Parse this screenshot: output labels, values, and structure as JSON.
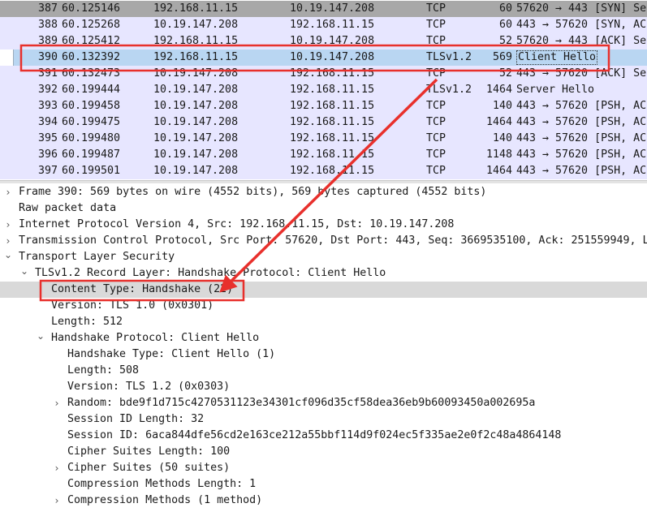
{
  "colors": {
    "tcp_row_bg": "#e7e6ff",
    "selected_row_bg": "#b9d6f2",
    "header_row_bg": "#a8a8a8",
    "annotation_red": "#e8302c",
    "selected_detail_bg": "#d9d9d9"
  },
  "packets": [
    {
      "no": "387",
      "time": "60.125146",
      "src": "192.168.11.15",
      "dst": "10.19.147.208",
      "proto": "TCP",
      "len": "60",
      "info": "57620 → 443 [SYN] Se",
      "style": "header"
    },
    {
      "no": "388",
      "time": "60.125268",
      "src": "10.19.147.208",
      "dst": "192.168.11.15",
      "proto": "TCP",
      "len": "60",
      "info": "443 → 57620 [SYN, AC",
      "style": "tcp"
    },
    {
      "no": "389",
      "time": "60.125412",
      "src": "192.168.11.15",
      "dst": "10.19.147.208",
      "proto": "TCP",
      "len": "52",
      "info": "57620 → 443 [ACK] Se",
      "style": "tcp"
    },
    {
      "no": "390",
      "time": "60.132392",
      "src": "192.168.11.15",
      "dst": "10.19.147.208",
      "proto": "TLSv1.2",
      "len": "569",
      "info": "Client Hello",
      "style": "selected"
    },
    {
      "no": "391",
      "time": "60.132473",
      "src": "10.19.147.208",
      "dst": "192.168.11.15",
      "proto": "TCP",
      "len": "52",
      "info": "443 → 57620 [ACK] Se",
      "style": "tcp"
    },
    {
      "no": "392",
      "time": "60.199444",
      "src": "10.19.147.208",
      "dst": "192.168.11.15",
      "proto": "TLSv1.2",
      "len": "1464",
      "info": "Server Hello",
      "style": "tcp"
    },
    {
      "no": "393",
      "time": "60.199458",
      "src": "10.19.147.208",
      "dst": "192.168.11.15",
      "proto": "TCP",
      "len": "140",
      "info": "443 → 57620 [PSH, AC",
      "style": "tcp"
    },
    {
      "no": "394",
      "time": "60.199475",
      "src": "10.19.147.208",
      "dst": "192.168.11.15",
      "proto": "TCP",
      "len": "1464",
      "info": "443 → 57620 [PSH, AC",
      "style": "tcp"
    },
    {
      "no": "395",
      "time": "60.199480",
      "src": "10.19.147.208",
      "dst": "192.168.11.15",
      "proto": "TCP",
      "len": "140",
      "info": "443 → 57620 [PSH, AC",
      "style": "tcp"
    },
    {
      "no": "396",
      "time": "60.199487",
      "src": "10.19.147.208",
      "dst": "192.168.11.15",
      "proto": "TCP",
      "len": "1148",
      "info": "443 → 57620 [PSH, AC",
      "style": "tcp"
    },
    {
      "no": "397",
      "time": "60.199501",
      "src": "10.19.147.208",
      "dst": "192.168.11.15",
      "proto": "TCP",
      "len": "1464",
      "info": "443 → 57620 [PSH, AC",
      "style": "tcp"
    }
  ],
  "details": [
    {
      "level": 0,
      "arrow": "collapsed",
      "text": "Frame 390: 569 bytes on wire (4552 bits), 569 bytes captured (4552 bits)"
    },
    {
      "level": 0,
      "arrow": "none",
      "text": "Raw packet data"
    },
    {
      "level": 0,
      "arrow": "collapsed",
      "text": "Internet Protocol Version 4, Src: 192.168.11.15, Dst: 10.19.147.208"
    },
    {
      "level": 0,
      "arrow": "collapsed",
      "text": "Transmission Control Protocol, Src Port: 57620, Dst Port: 443, Seq: 3669535100, Ack: 251559949, L"
    },
    {
      "level": 0,
      "arrow": "expanded",
      "text": "Transport Layer Security"
    },
    {
      "level": 1,
      "arrow": "expanded",
      "text": "TLSv1.2 Record Layer: Handshake Protocol: Client Hello"
    },
    {
      "level": 2,
      "arrow": "none",
      "text": "Content Type: Handshake (22)",
      "selected": true
    },
    {
      "level": 2,
      "arrow": "none",
      "text": "Version: TLS 1.0 (0x0301)"
    },
    {
      "level": 2,
      "arrow": "none",
      "text": "Length: 512"
    },
    {
      "level": 2,
      "arrow": "expanded",
      "text": "Handshake Protocol: Client Hello"
    },
    {
      "level": 3,
      "arrow": "none",
      "text": "Handshake Type: Client Hello (1)"
    },
    {
      "level": 3,
      "arrow": "none",
      "text": "Length: 508"
    },
    {
      "level": 3,
      "arrow": "none",
      "text": "Version: TLS 1.2 (0x0303)"
    },
    {
      "level": 3,
      "arrow": "collapsed",
      "text": "Random: bde9f1d715c4270531123e34301cf096d35cf58dea36eb9b60093450a002695a"
    },
    {
      "level": 3,
      "arrow": "none",
      "text": "Session ID Length: 32"
    },
    {
      "level": 3,
      "arrow": "none",
      "text": "Session ID: 6aca844dfe56cd2e163ce212a55bbf114d9f024ec5f335ae2e0f2c48a4864148"
    },
    {
      "level": 3,
      "arrow": "none",
      "text": "Cipher Suites Length: 100"
    },
    {
      "level": 3,
      "arrow": "collapsed",
      "text": "Cipher Suites (50 suites)"
    },
    {
      "level": 3,
      "arrow": "none",
      "text": "Compression Methods Length: 1"
    },
    {
      "level": 3,
      "arrow": "collapsed",
      "text": "Compression Methods (1 method)"
    }
  ]
}
